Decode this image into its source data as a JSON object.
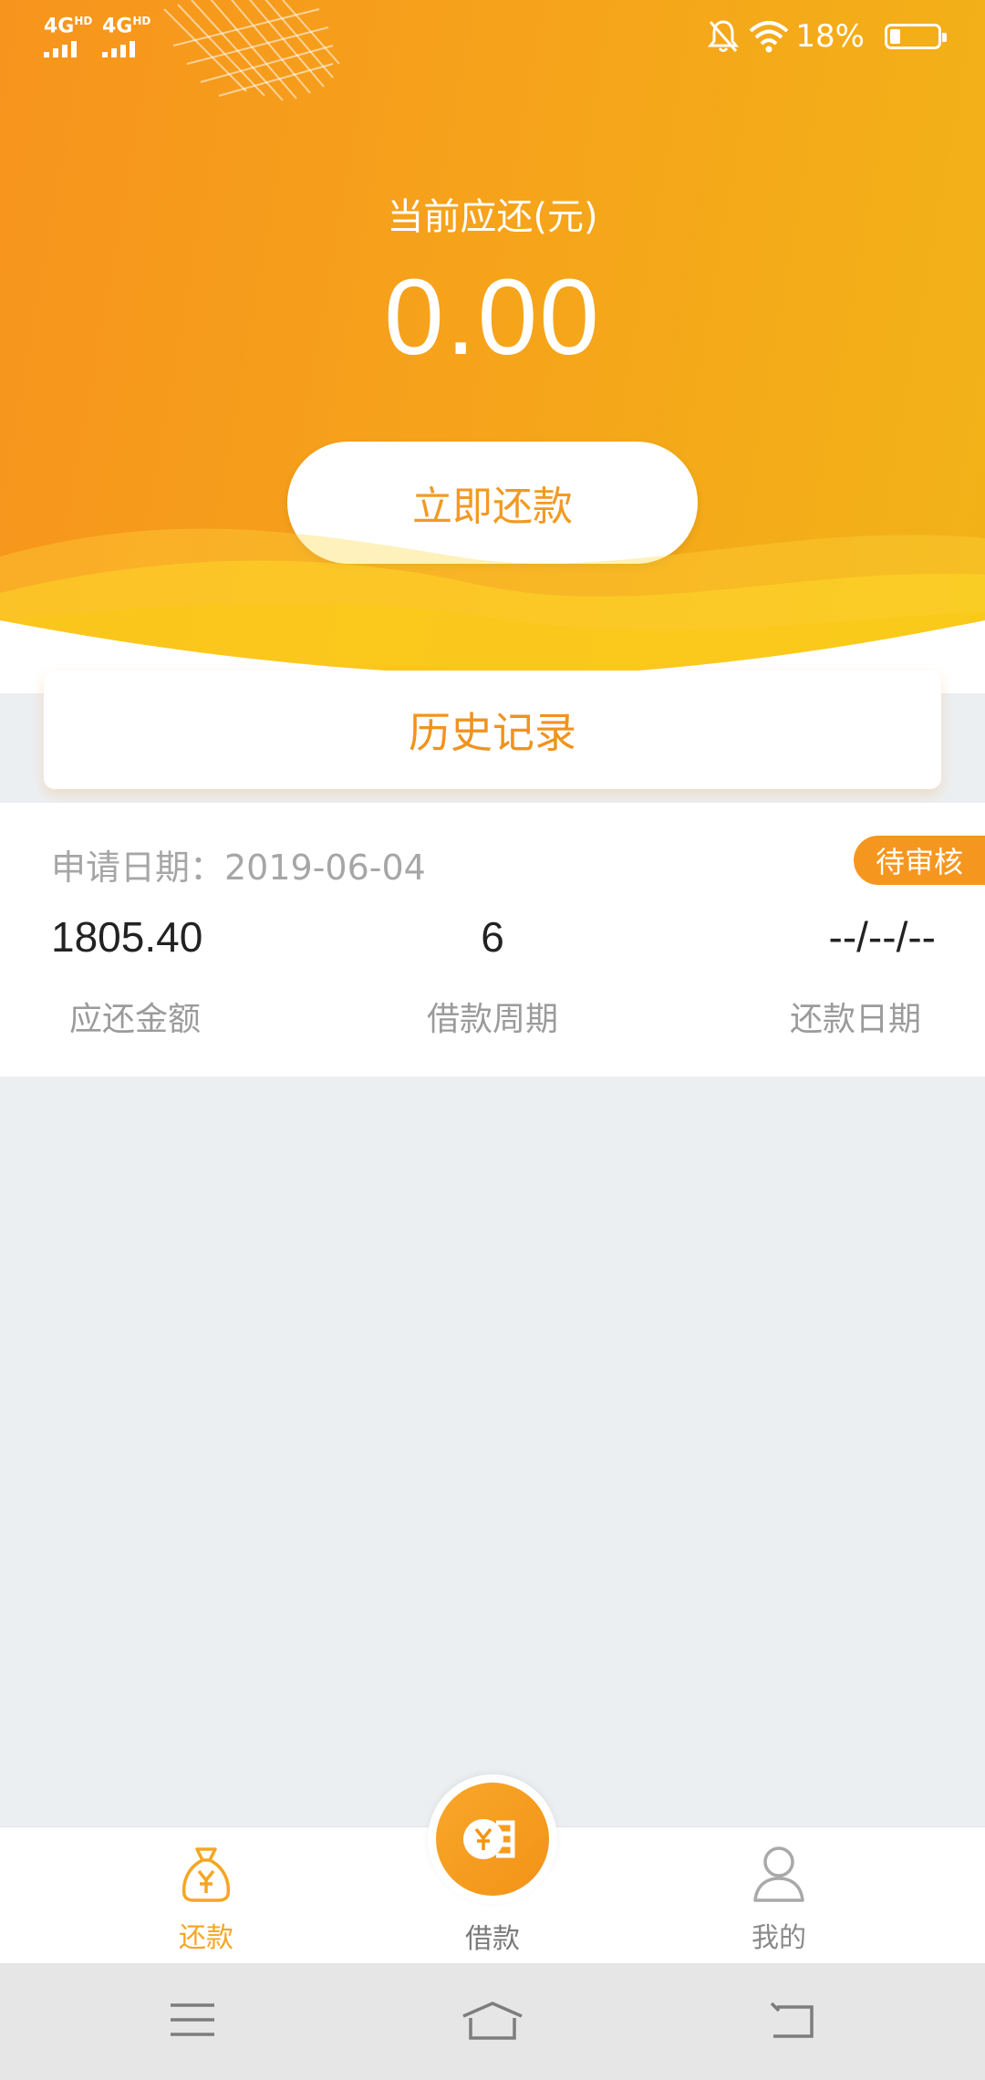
{
  "status_bar": {
    "signal_1": "4G",
    "signal_2": "4G",
    "signal_sup": "HD",
    "battery_text": "18%",
    "battery_level": 0.18,
    "icons": [
      "bell-off-icon",
      "wifi-icon",
      "battery-icon"
    ]
  },
  "header": {
    "due_label": "当前应还(元)",
    "due_amount": "0.00",
    "repay_button": "立即还款"
  },
  "history": {
    "label": "历史记录"
  },
  "record": {
    "apply_date": "申请日期：2019-06-04",
    "status": "待审核",
    "amount": "1805.40",
    "amount_label": "应还金额",
    "period": "6",
    "period_label": "借款周期",
    "repay_date": "--/--/--",
    "repay_date_label": "还款日期"
  },
  "tabbar": {
    "tabs": [
      {
        "label": "还款",
        "icon": "money-bag-icon",
        "active": true
      },
      {
        "label": "借款",
        "icon": "coin-icon",
        "active": false
      },
      {
        "label": "我的",
        "icon": "user-icon",
        "active": false
      }
    ]
  },
  "system_nav": {
    "icons": [
      "menu-icon",
      "home-icon",
      "back-icon"
    ]
  },
  "colors": {
    "accent": "#f5971f",
    "header_gradient_start": "#f7941d",
    "header_gradient_end": "#f2b317",
    "background": "#eceff2"
  }
}
